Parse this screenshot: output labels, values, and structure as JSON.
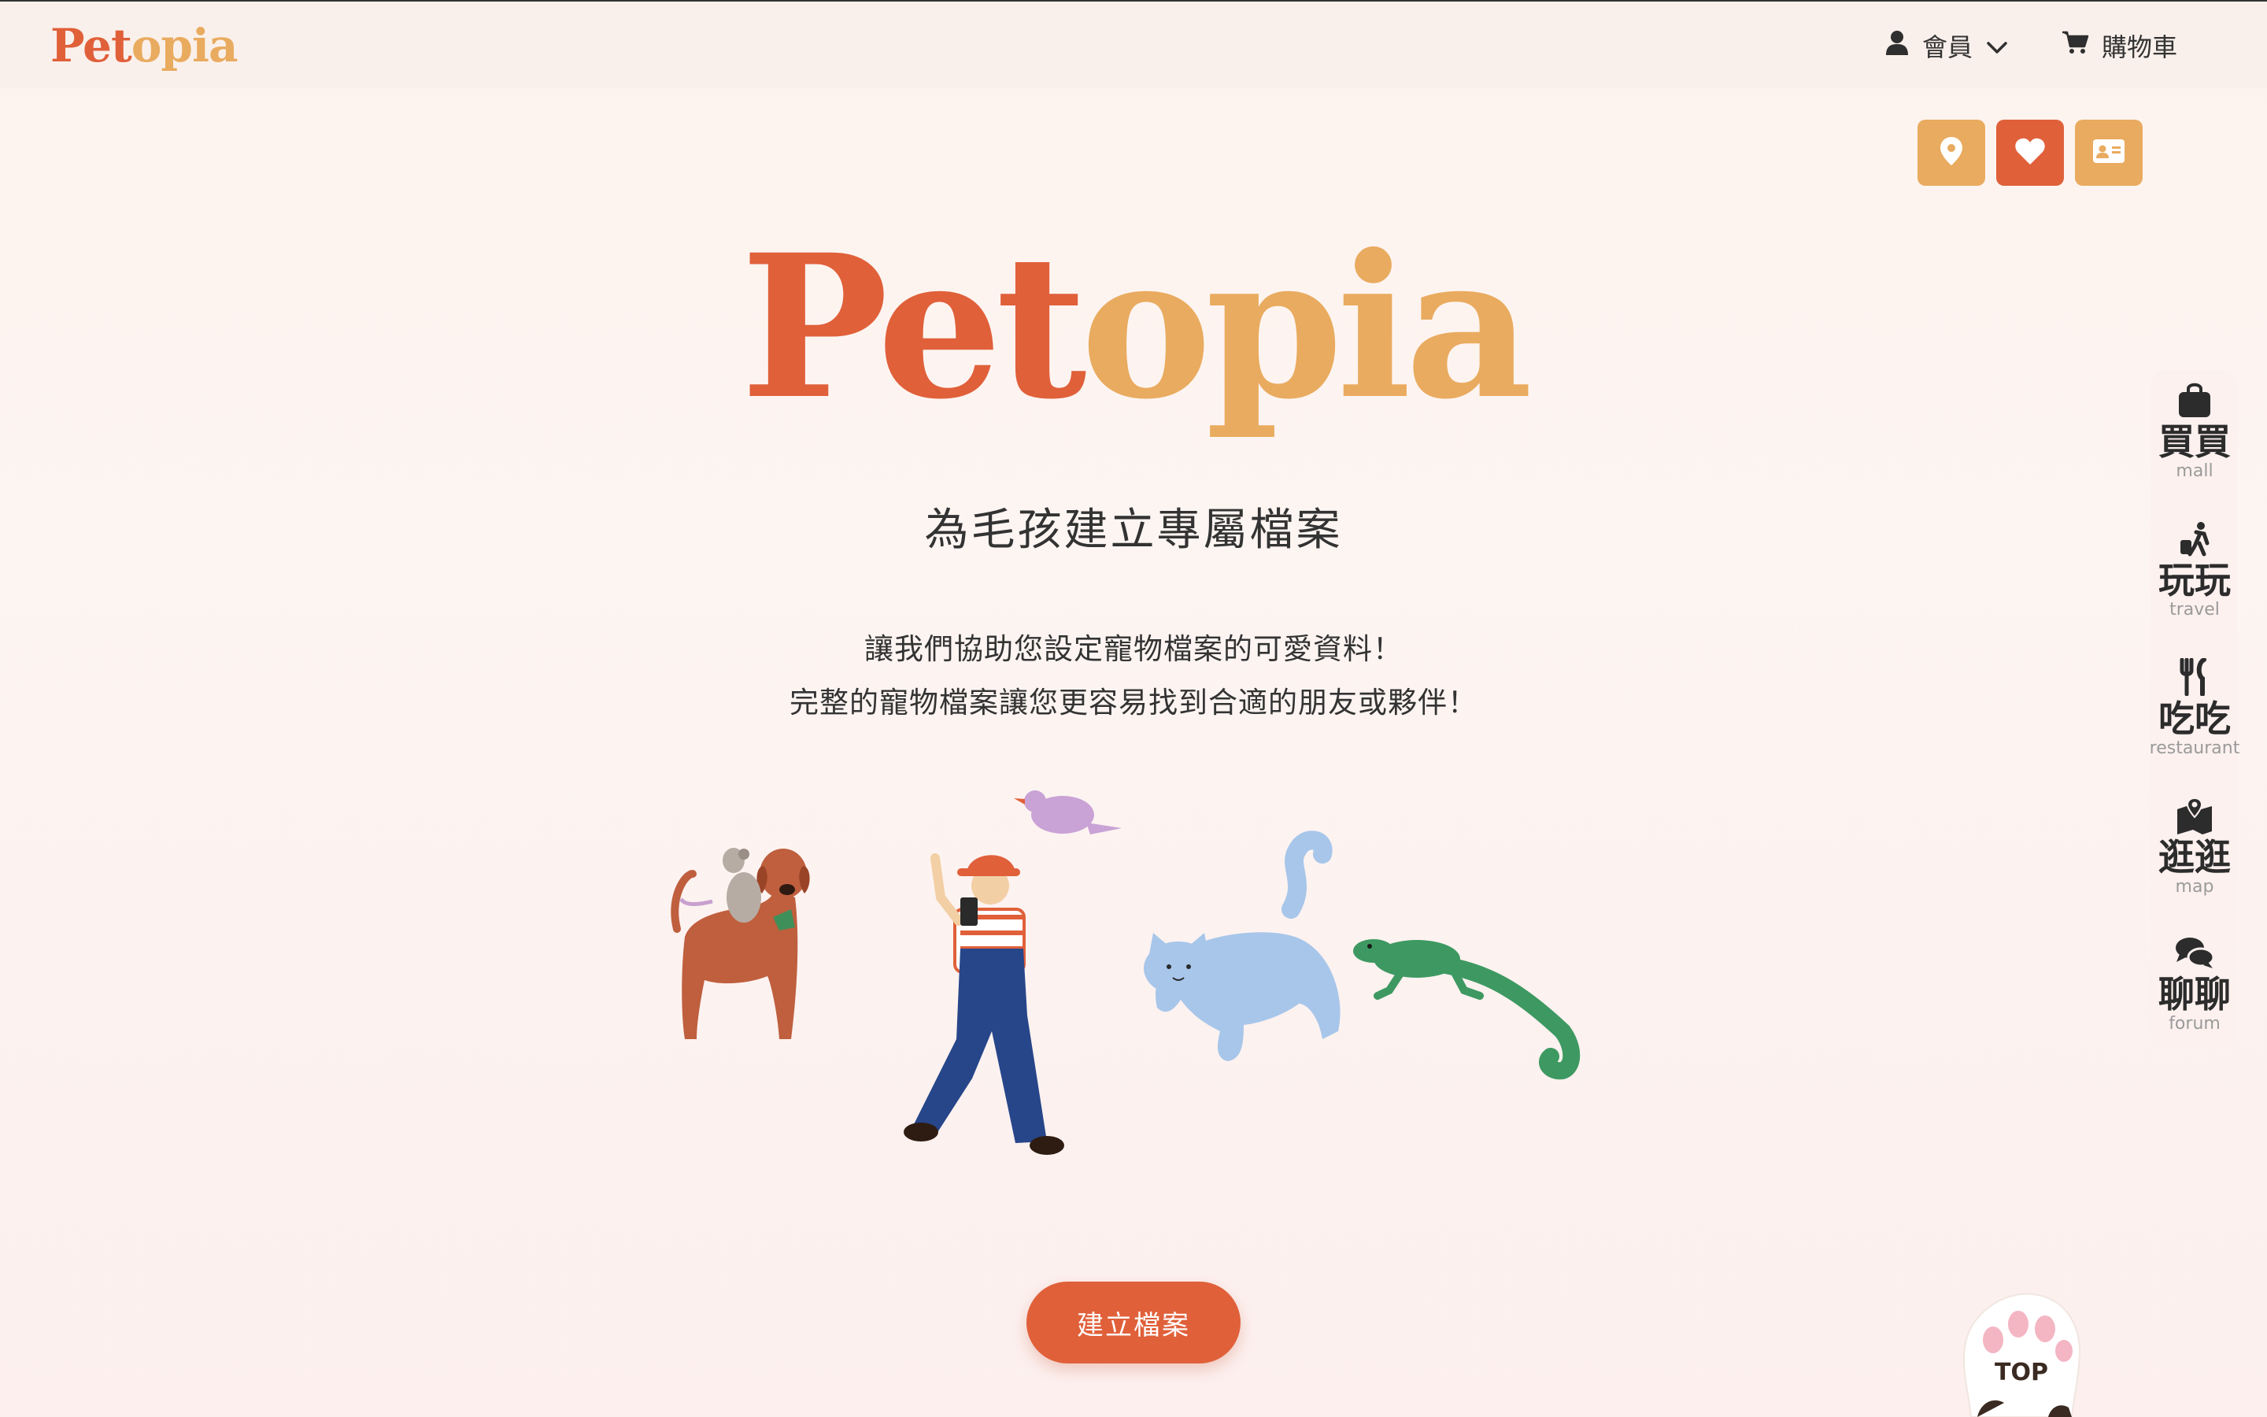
{
  "header": {
    "logo": {
      "part1": "Pet",
      "part2": "opia"
    },
    "member_label": "會員",
    "cart_label": "購物車"
  },
  "quick_actions": [
    {
      "icon": "location-pin-icon",
      "color": "#e9ab5f"
    },
    {
      "icon": "heart-icon",
      "color": "#e0603a"
    },
    {
      "icon": "id-card-icon",
      "color": "#e9ab5f"
    }
  ],
  "hero": {
    "logo": {
      "part1": "Pet",
      "part2": "opia"
    },
    "subtitle": "為毛孩建立專屬檔案",
    "desc_line1": "讓我們協助您設定寵物檔案的可愛資料！",
    "desc_line2": "完整的寵物檔案讓您更容易找到合適的朋友或夥伴！",
    "cta_label": "建立檔案"
  },
  "sidenav": [
    {
      "zh": "買買",
      "en": "mall",
      "icon": "shopping-bag-icon"
    },
    {
      "zh": "玩玩",
      "en": "travel",
      "icon": "traveler-icon"
    },
    {
      "zh": "吃吃",
      "en": "restaurant",
      "icon": "utensils-icon"
    },
    {
      "zh": "逛逛",
      "en": "map",
      "icon": "map-icon"
    },
    {
      "zh": "聊聊",
      "en": "forum",
      "icon": "chat-icon"
    }
  ],
  "top_button": {
    "label": "TOP",
    "icon": "paw-icon"
  },
  "colors": {
    "brand_red": "#e0603a",
    "brand_orange": "#e9ab5f",
    "text_dark": "#333333"
  }
}
